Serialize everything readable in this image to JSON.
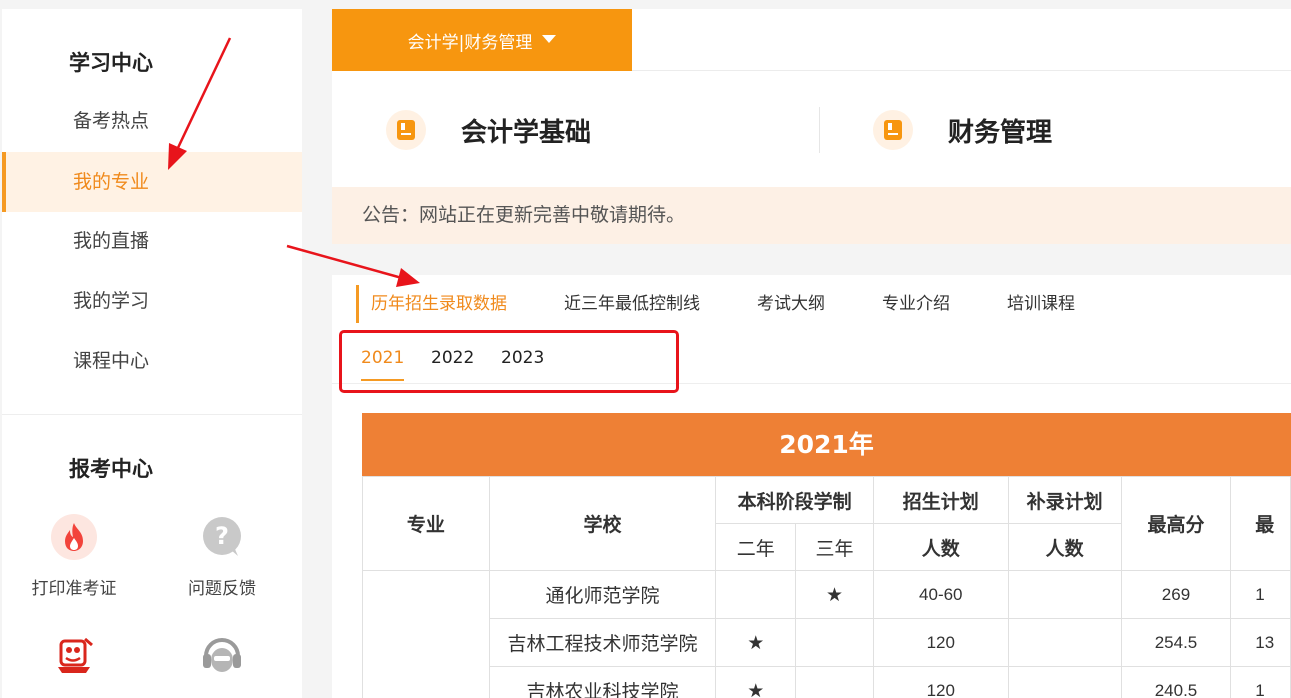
{
  "sidebar": {
    "study_center_title": "学习中心",
    "nav": [
      {
        "label": "备考热点"
      },
      {
        "label": "我的专业"
      },
      {
        "label": "我的直播"
      },
      {
        "label": "我的学习"
      },
      {
        "label": "课程中心"
      }
    ],
    "exam_center_title": "报考中心",
    "tools": [
      {
        "label": "打印准考证",
        "icon": "fire-icon"
      },
      {
        "label": "问题反馈",
        "icon": "question-icon"
      },
      {
        "label": "",
        "icon": "stamp-icon"
      },
      {
        "label": "",
        "icon": "headset-icon"
      }
    ]
  },
  "major_selector": {
    "label": "会计学|财务管理"
  },
  "courses": [
    {
      "label": "会计学基础",
      "icon": "book-icon"
    },
    {
      "label": "财务管理",
      "icon": "book-icon"
    }
  ],
  "notice": {
    "text": "公告：网站正在更新完善中敬请期待。"
  },
  "tabs": [
    {
      "label": "历年招生录取数据",
      "active": true
    },
    {
      "label": "近三年最低控制线"
    },
    {
      "label": "考试大纲"
    },
    {
      "label": "专业介绍"
    },
    {
      "label": "培训课程"
    }
  ],
  "years": [
    {
      "label": "2021",
      "active": true
    },
    {
      "label": "2022"
    },
    {
      "label": "2023"
    }
  ],
  "table": {
    "title": "2021年",
    "headers": {
      "major": "专业",
      "school": "学校",
      "system": "本科阶段学制",
      "plan": "招生计划",
      "supplement": "补录计划",
      "max": "最高分",
      "min_partial": "最",
      "two_year": "二年",
      "three_year": "三年",
      "plan_count": "人数",
      "supp_count": "人数"
    },
    "rows": [
      {
        "school": "通化师范学院",
        "two": "",
        "three": "★",
        "plan": "40-60",
        "supp": "",
        "max": "269",
        "min": "1"
      },
      {
        "school": "吉林工程技术师范学院",
        "two": "★",
        "three": "",
        "plan": "120",
        "supp": "",
        "max": "254.5",
        "min": "13"
      },
      {
        "school": "吉林农业科技学院",
        "two": "★",
        "three": "",
        "plan": "120",
        "supp": "",
        "max": "240.5",
        "min": "1"
      }
    ]
  },
  "colors": {
    "accent": "#f7960f",
    "accent_text": "#f08a1c",
    "table_header": "#ee8035",
    "annotation": "#e8141b"
  }
}
